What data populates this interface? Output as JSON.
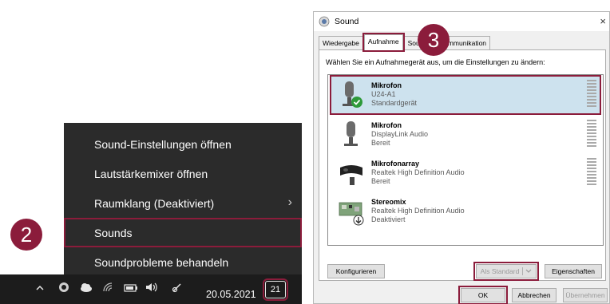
{
  "context_menu": {
    "items": [
      {
        "label": "Sound-Einstellungen öffnen"
      },
      {
        "label": "Lautstärkemixer öffnen"
      },
      {
        "label": "Raumklang (Deaktiviert)",
        "chevron": "›"
      },
      {
        "label": "Sounds"
      },
      {
        "label": "Soundprobleme behandeln"
      }
    ]
  },
  "taskbar": {
    "date": "20.05.2021",
    "notification_count": "21",
    "icons": [
      "chevron-up-icon",
      "security-icon",
      "cloud-icon",
      "wifi-icon",
      "battery-icon",
      "volume-icon",
      "pen-icon"
    ]
  },
  "badges": {
    "step2": "2",
    "step3": "3"
  },
  "dialog": {
    "title": "Sound",
    "close": "×",
    "tabs": [
      "Wiedergabe",
      "Aufnahme",
      "Sounds",
      "Kommunikation"
    ],
    "active_tab": "Aufnahme",
    "instruction": "Wählen Sie ein Aufnahmegerät aus, um die Einstellungen zu ändern:",
    "devices": [
      {
        "name": "Mikrofon",
        "desc": "U24-A1",
        "status": "Standardgerät"
      },
      {
        "name": "Mikrofon",
        "desc": "DisplayLink Audio",
        "status": "Bereit"
      },
      {
        "name": "Mikrofonarray",
        "desc": "Realtek High Definition Audio",
        "status": "Bereit"
      },
      {
        "name": "Stereomix",
        "desc": "Realtek High Definition Audio",
        "status": "Deaktiviert"
      }
    ],
    "buttons": {
      "configure": "Konfigurieren",
      "set_default": "Als Standard",
      "properties": "Eigenschaften",
      "ok": "OK",
      "cancel": "Abbrechen",
      "apply": "Übernehmen"
    }
  },
  "colors": {
    "accent": "#8b1c3b",
    "selection": "#cde2ee",
    "menu_bg": "#2b2b2b"
  }
}
